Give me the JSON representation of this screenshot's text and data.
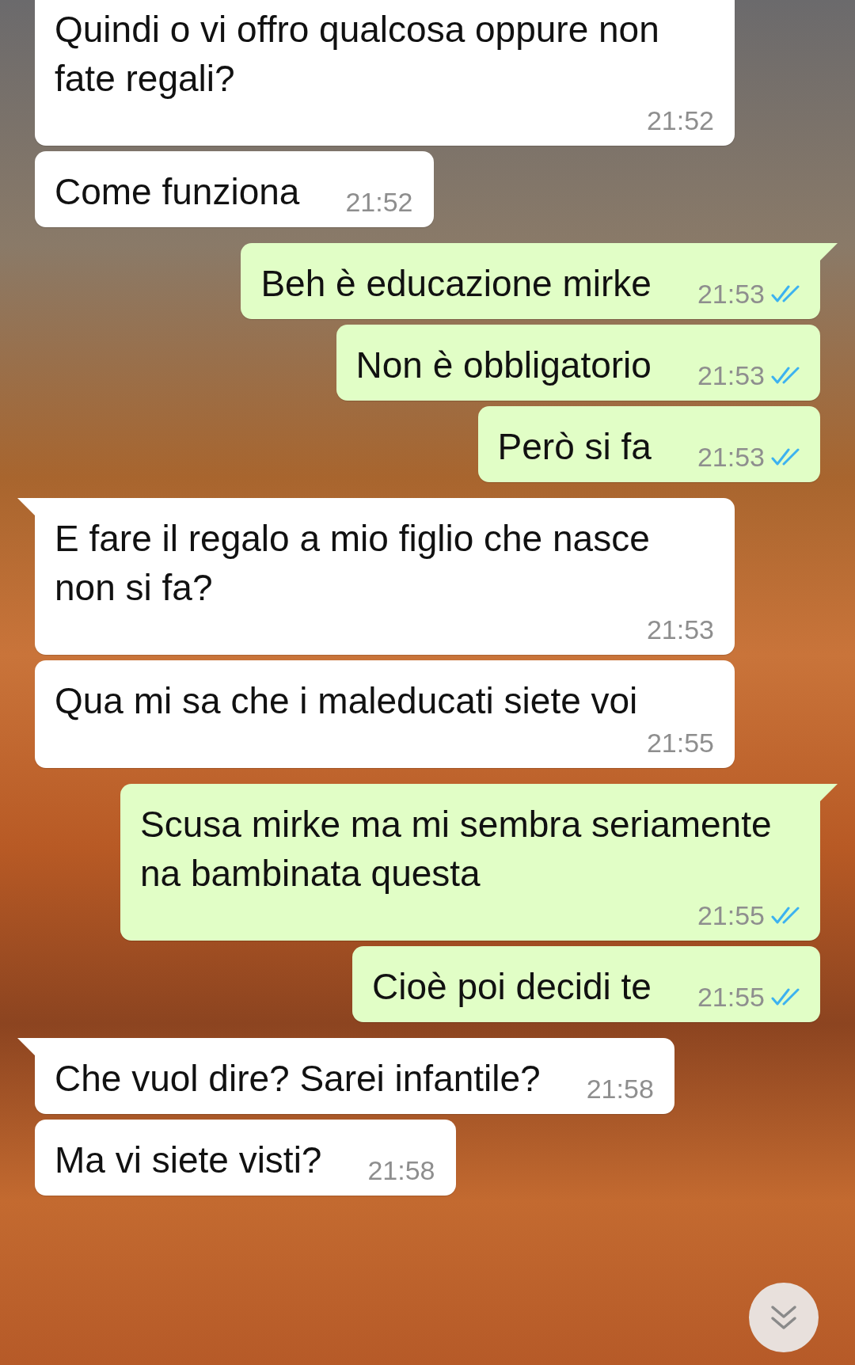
{
  "messages": [
    {
      "kind": "in",
      "tail": false,
      "text": "Quindi o vi offro qualcosa oppure non fate regali?",
      "time": "21:52"
    },
    {
      "kind": "in",
      "tail": false,
      "text": "Come funziona",
      "time": "21:52"
    },
    {
      "kind": "out",
      "tail": true,
      "text": "Beh è educazione mirke",
      "time": "21:53",
      "read": true
    },
    {
      "kind": "out",
      "tail": false,
      "text": "Non è obbligatorio",
      "time": "21:53",
      "read": true
    },
    {
      "kind": "out",
      "tail": false,
      "text": "Però si fa",
      "time": "21:53",
      "read": true
    },
    {
      "kind": "in",
      "tail": true,
      "text": "E fare il regalo a mio figlio che nasce non si fa?",
      "time": "21:53"
    },
    {
      "kind": "in",
      "tail": false,
      "text": "Qua mi sa che i maleducati siete voi",
      "time": "21:55"
    },
    {
      "kind": "out",
      "tail": true,
      "text": "Scusa mirke ma mi sembra seriamente na bambinata questa",
      "time": "21:55",
      "read": true
    },
    {
      "kind": "out",
      "tail": false,
      "text": "Cioè poi decidi te",
      "time": "21:55",
      "read": true
    },
    {
      "kind": "in",
      "tail": true,
      "text": "Che vuol dire? Sarei infantile?",
      "time": "21:58"
    },
    {
      "kind": "in",
      "tail": false,
      "text": "Ma vi siete visti?",
      "time": "21:58"
    }
  ]
}
